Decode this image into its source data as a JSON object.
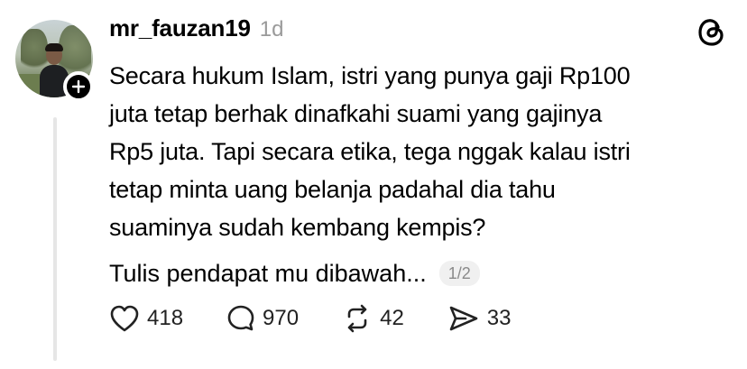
{
  "post": {
    "username": "mr_fauzan19",
    "time": "1d",
    "text_lines": [
      "Secara hukum Islam, istri yang punya gaji Rp100",
      "juta tetap berhak dinafkahi suami yang gajinya",
      "Rp5 juta. Tapi secara etika, tega nggak kalau istri",
      "tetap minta uang belanja padahal dia tahu",
      "suaminya sudah kembang kempis?"
    ],
    "more_text": "Tulis pendapat mu dibawah...",
    "page_indicator": "1/2"
  },
  "actions": {
    "likes": "418",
    "comments": "970",
    "reposts": "42",
    "shares": "33"
  },
  "icons": [
    "plus-icon",
    "threads-logo-icon",
    "heart-icon",
    "comment-icon",
    "repost-icon",
    "share-icon"
  ]
}
